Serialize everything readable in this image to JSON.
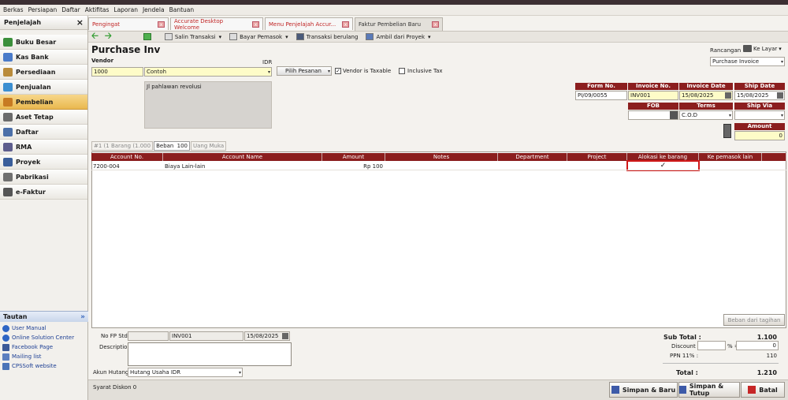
{
  "menubar": [
    "Berkas",
    "Persiapan",
    "Daftar",
    "Aktifitas",
    "Laporan",
    "Jendela",
    "Bantuan"
  ],
  "sidebar": {
    "title": "Penjelajah",
    "close": "×",
    "items": [
      {
        "label": "Buku Besar",
        "color": "#3b8f3b"
      },
      {
        "label": "Kas Bank",
        "color": "#4a7bc9"
      },
      {
        "label": "Persediaan",
        "color": "#b98b3b"
      },
      {
        "label": "Penjualan",
        "color": "#3c8fd1"
      },
      {
        "label": "Pembelian",
        "color": "#c77a22"
      },
      {
        "label": "Aset Tetap",
        "color": "#6b6b6b"
      },
      {
        "label": "Daftar",
        "color": "#4b6fa8"
      },
      {
        "label": "RMA",
        "color": "#5e5e8e"
      },
      {
        "label": "Proyek",
        "color": "#3a5e9a"
      },
      {
        "label": "Pabrikasi",
        "color": "#707070"
      },
      {
        "label": "e-Faktur",
        "color": "#555555"
      }
    ],
    "tautan_title": "Tautan",
    "links": [
      "User Manual",
      "Online Solution Center",
      "Facebook Page",
      "Mailing list",
      "CPSSoft website"
    ]
  },
  "tabs": [
    "Pengingat",
    "Accurate Desktop Welcome",
    "Menu Penjelajah Accur...",
    "Faktur Pembelian Baru"
  ],
  "toolbar": {
    "copy": "Salin Transaksi",
    "pay": "Bayar Pemasok",
    "recur": "Transaksi berulang",
    "project": "Ambil dari Proyek"
  },
  "form": {
    "title": "Purchase Inv",
    "vendor_label": "Vendor",
    "currency": "IDR",
    "vendor_code": "1000",
    "vendor_name": "Contoh",
    "pick_order": "Pilih Pesanan",
    "vendor_taxable": "Vendor is Taxable",
    "inclusive_tax": "Inclusive Tax",
    "address": "Jl pahlawan revolusi",
    "design_label": "Rancangan",
    "to_screen": "Ke Layar",
    "template": "Purchase Invoice",
    "headers": {
      "form_no": "Form No.",
      "invoice_no": "Invoice No.",
      "invoice_date": "Invoice Date",
      "ship_date": "Ship Date",
      "fob": "FOB",
      "terms": "Terms",
      "ship_via": "Ship Via",
      "amount": "Amount"
    },
    "form_no": "PI/09/0055",
    "invoice_no": "INV001",
    "invoice_date": "15/08/2025",
    "ship_date": "15/08/2025",
    "terms": "C.O.D",
    "amount": "0"
  },
  "subtabs": [
    "#1 (1 Barang (1.000",
    "Beban",
    "100",
    "Uang Muka"
  ],
  "grid": {
    "columns": [
      "Account No.",
      "Account Name",
      "Amount",
      "Notes",
      "Department",
      "Project",
      "Alokasi ke barang",
      "Ke pemasok lain"
    ],
    "rows": [
      {
        "acc_no": "7200-004",
        "acc_name": "Biaya Lain-lain",
        "amount": "Rp 100",
        "alloc": "✓"
      }
    ]
  },
  "beban_button": "Beban dari tagihan",
  "footer": {
    "fp_label": "No FP Std",
    "fp_invoice": "INV001",
    "fp_date": "15/08/2025",
    "desc_label": "Description",
    "ap_label": "Akun Hutang",
    "ap_value": "Hutang Usaha IDR",
    "terms_disc": "Syarat Diskon 0",
    "subtotal_label": "Sub Total :",
    "subtotal": "1.100",
    "discount_label": "Discount :",
    "discount_pct_suffix": "% =",
    "discount": "0",
    "ppn_label": "PPN 11% :",
    "ppn": "110",
    "total_label": "Total :",
    "total": "1.210"
  },
  "buttons": {
    "save_new": "Simpan & Baru",
    "save_close": "Simpan & Tutup",
    "cancel": "Batal"
  }
}
